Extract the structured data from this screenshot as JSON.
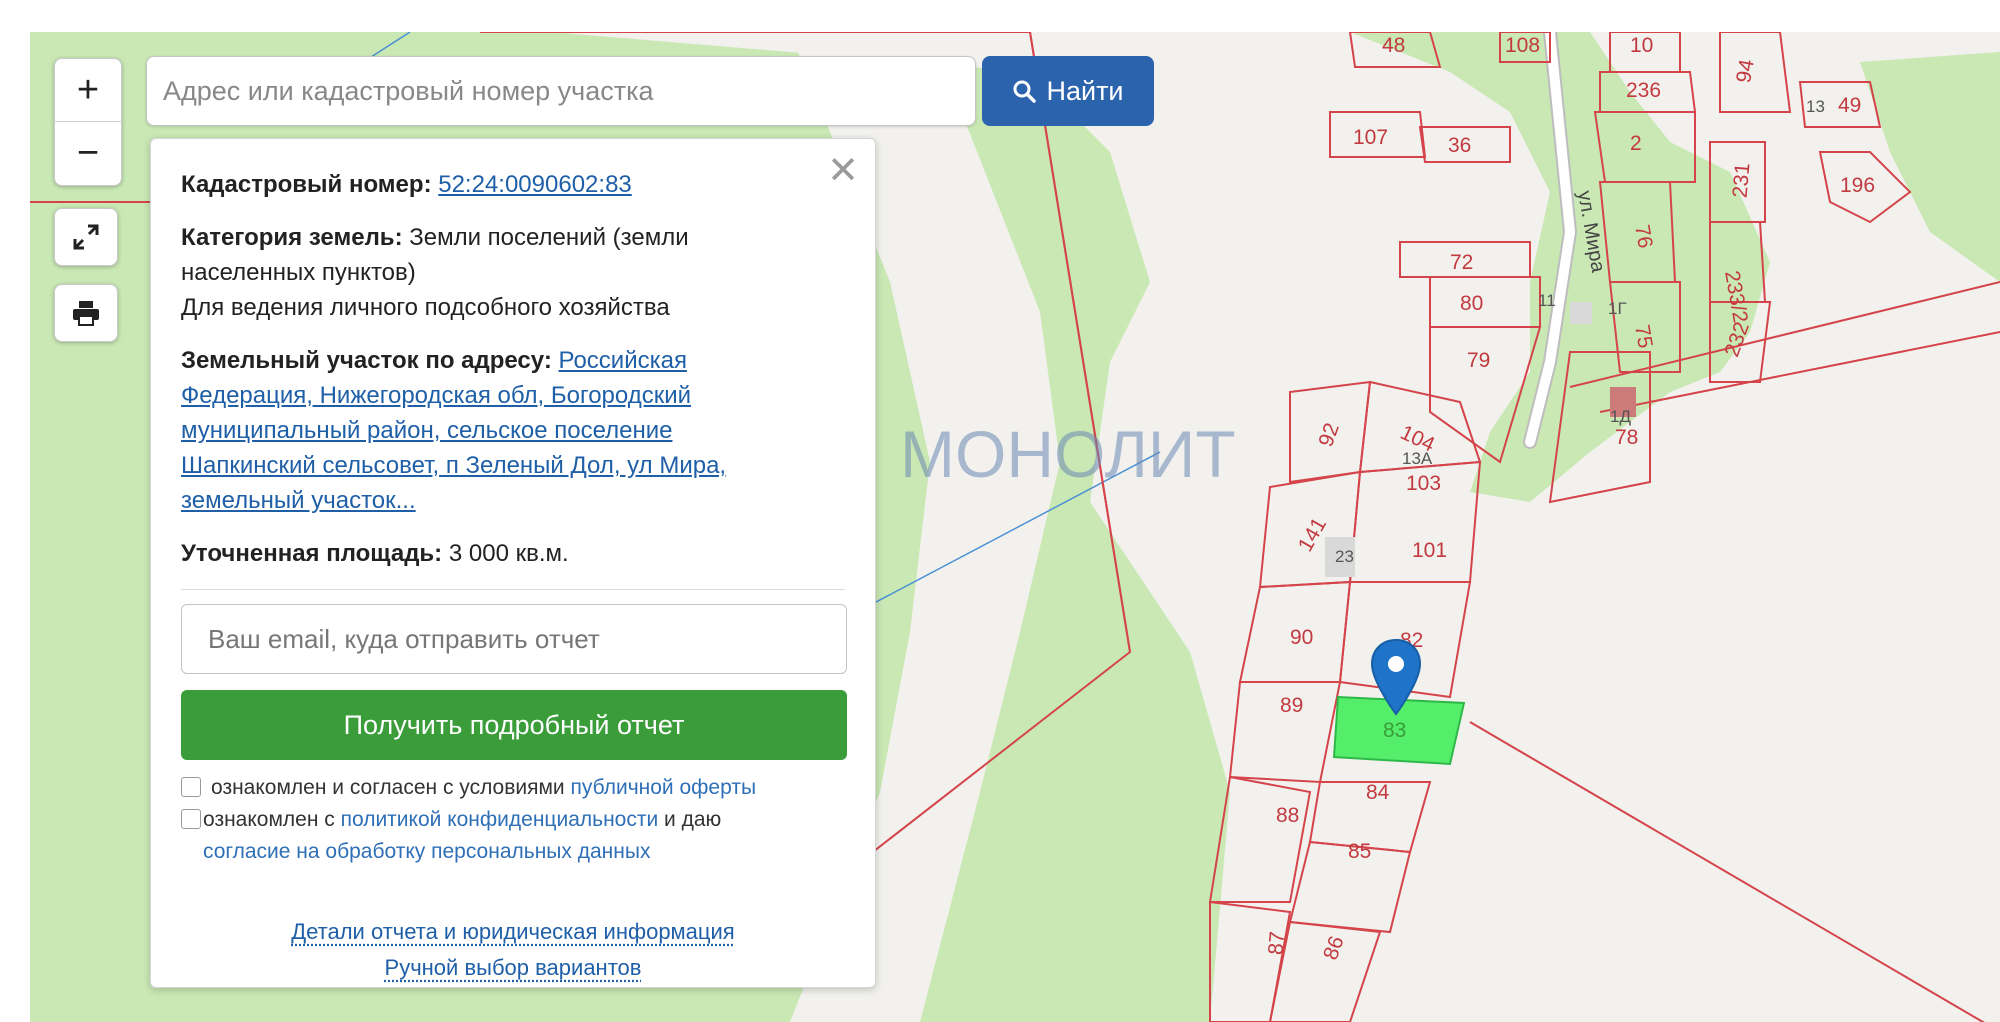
{
  "search": {
    "placeholder": "Адрес или кадастровый номер участка",
    "button_label": "Найти"
  },
  "controls": {
    "zoom_in": "+",
    "zoom_out": "−"
  },
  "panel": {
    "cadastral_label": "Кадастровый номер:",
    "cadastral_value": "52:24:0090602:83",
    "category_label": "Категория земель:",
    "category_value": "Земли поселений (земли населенных пунктов)",
    "use_value": "Для ведения личного подсобного хозяйства",
    "address_label": "Земельный участок по адресу:",
    "address_value": "Российская Федерация, Нижегородская обл, Богородский муниципальный район, сельское поселение Шапкинский сельсовет, п Зеленый Дол, ул Мира, земельный участок...",
    "area_label": "Уточненная площадь:",
    "area_value": "3 000 кв.м.",
    "email_placeholder": "Ваш email, куда отправить отчет",
    "report_button": "Получить подробный отчет",
    "agree1_text": "ознакомлен и согласен с условиями",
    "agree1_link": "публичной оферты",
    "agree2_text": "ознакомлен с",
    "agree2_link": "политикой конфиденциальности",
    "agree2_text2": "и даю",
    "agree2_link2": "согласие на обработку персональных данных",
    "details_link": "Детали отчета и юридическая информация",
    "manual_link": "Ручной выбор вариантов"
  },
  "map": {
    "watermark": "МОНОЛИТ",
    "street_label": "ул. Мира",
    "colors": {
      "forest": "#c9e8b4",
      "land": "#f2f1ed",
      "boundary": "#d4444a",
      "selected": "#55ee6a",
      "marker": "#1f73c9"
    },
    "plot_labels": {
      "p48": "48",
      "p108": "108",
      "p10": "10",
      "p236": "236",
      "p94": "94",
      "p13": "13",
      "p49": "49",
      "p107": "107",
      "p36": "36",
      "p2": "2",
      "p231": "231",
      "p196": "196",
      "p72": "72",
      "p76": "76",
      "p2332": "233/2",
      "p80": "80",
      "p11": "11",
      "p1g": "1Г",
      "p75": "75",
      "p232": "232",
      "p79": "79",
      "p1d": "1Д",
      "p78": "78",
      "p92": "92",
      "p104": "104",
      "p13a": "13А",
      "p103": "103",
      "p141": "141",
      "p23": "23",
      "p101": "101",
      "p90": "90",
      "p82": "82",
      "p89": "89",
      "p83": "83",
      "p84": "84",
      "p88": "88",
      "p85": "85",
      "p87": "87",
      "p86": "86"
    }
  }
}
